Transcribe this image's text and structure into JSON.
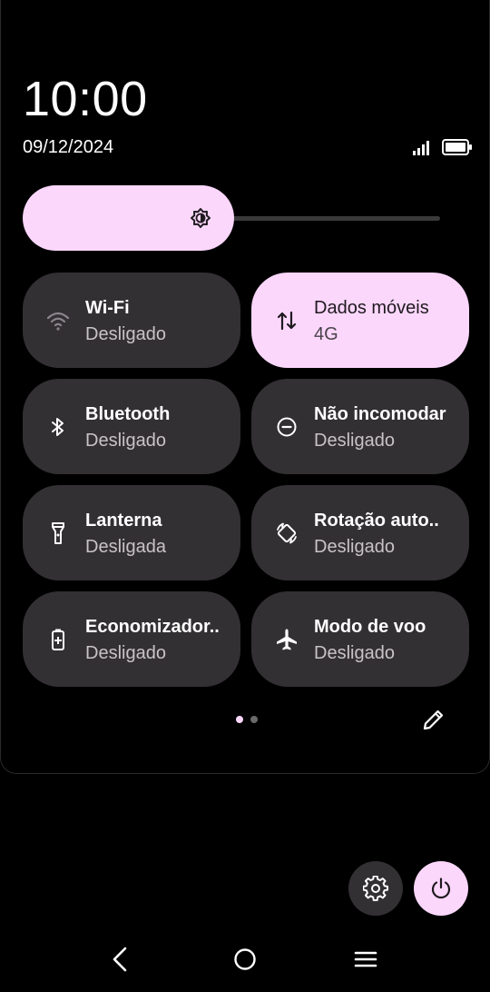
{
  "header": {
    "time": "10:00",
    "date": "09/12/2024",
    "signal_icon": "cell-signal-icon",
    "battery_icon": "battery-icon"
  },
  "brightness": {
    "level": 0.47,
    "icon": "brightness-icon"
  },
  "tiles": [
    {
      "title": "Wi-Fi",
      "subtitle": "Desligado",
      "icon": "wifi-icon",
      "active": false
    },
    {
      "title": "Dados móveis",
      "subtitle": "4G",
      "icon": "mobile-data-icon",
      "active": true
    },
    {
      "title": "Bluetooth",
      "subtitle": "Desligado",
      "icon": "bluetooth-icon",
      "active": false
    },
    {
      "title": "Não incomodar",
      "subtitle": "Desligado",
      "icon": "do-not-disturb-icon",
      "active": false
    },
    {
      "title": "Lanterna",
      "subtitle": "Desligada",
      "icon": "flashlight-icon",
      "active": false
    },
    {
      "title": "Rotação auto..",
      "subtitle": "Desligado",
      "icon": "auto-rotate-icon",
      "active": false
    },
    {
      "title": "Economizador..",
      "subtitle": "Desligado",
      "icon": "battery-saver-icon",
      "active": false
    },
    {
      "title": "Modo de voo",
      "subtitle": "Desligado",
      "icon": "airplane-icon",
      "active": false
    }
  ],
  "pager": {
    "pages": 2,
    "current": 1
  },
  "colors": {
    "accent": "#fcd7fc",
    "tile": "#333033",
    "background": "#000000"
  }
}
